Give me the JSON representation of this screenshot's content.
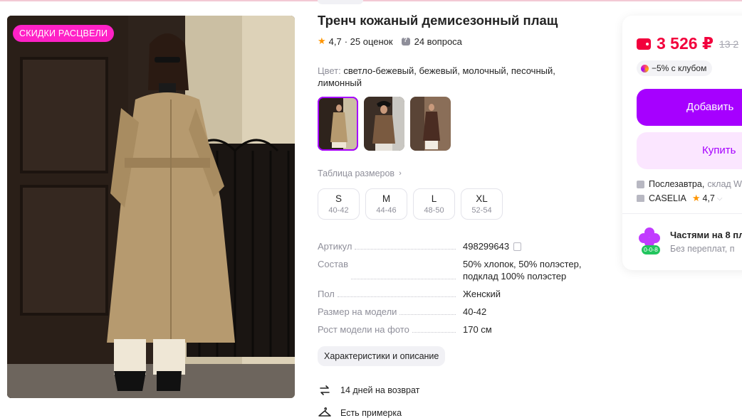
{
  "product": {
    "sale_badge": "СКИДКИ РАСЦВЕЛИ",
    "title": "Тренч кожаный демисезонный плащ",
    "rating": "4,7",
    "reviews": "· 25 оценок",
    "questions": "24 вопроса",
    "color_label": "Цвет:",
    "color_value": "светло-бежевый, бежевый, молочный, песочный, лимонный",
    "size_table_link": "Таблица размеров",
    "sizes": [
      {
        "size": "S",
        "ru": "40-42"
      },
      {
        "size": "M",
        "ru": "44-46"
      },
      {
        "size": "L",
        "ru": "48-50"
      },
      {
        "size": "XL",
        "ru": "52-54"
      }
    ],
    "specs": [
      {
        "key": "Артикул",
        "value": "498299643"
      },
      {
        "key": "Состав",
        "value": "50% хлопок, 50% полэстер, подклад 100% полэстер"
      },
      {
        "key": "Пол",
        "value": "Женский"
      },
      {
        "key": "Размер на модели",
        "value": "40-42"
      },
      {
        "key": "Рост модели на фото",
        "value": "170 см"
      }
    ],
    "characteristics_button": "Характеристики и описание",
    "features": {
      "returns": "14 дней на возврат",
      "fitting": "Есть примерка"
    }
  },
  "purchase": {
    "price": "3 526 ₽",
    "old_price": "13 2",
    "club_discount": "−5% с клубом",
    "add_button": "Добавить",
    "buy_button": "Купить",
    "delivery": "Послезавтра,",
    "warehouse": "склад W",
    "seller": "CASELIA",
    "seller_rating": "4,7",
    "installments_title": "Частями на 8 пл",
    "installments_sub": "Без переплат, п",
    "installments_badge": "0-0-8"
  },
  "colors": {
    "accent": "#a600ff",
    "price": "#f2003c",
    "badge": "#ff21c6"
  },
  "icons": [
    "star-icon",
    "question-icon",
    "copy-icon",
    "chevron-right-icon",
    "return-arrows-icon",
    "hanger-icon",
    "wallet-icon",
    "club-icon",
    "box-icon",
    "shop-icon",
    "flower-icon"
  ]
}
